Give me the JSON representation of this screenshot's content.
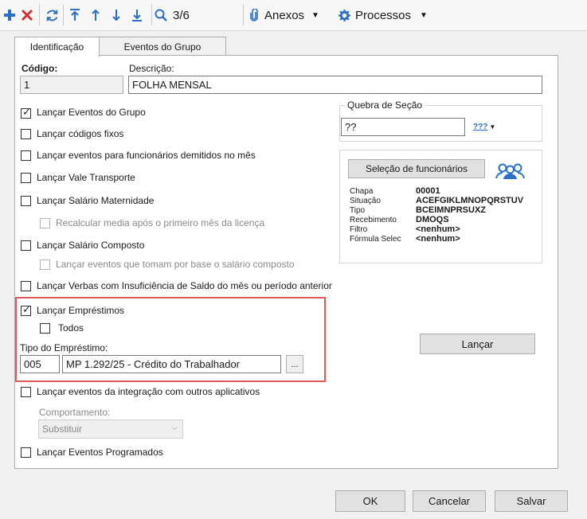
{
  "toolbar": {
    "counter": "3/6",
    "anexos_label": "Anexos",
    "processos_label": "Processos",
    "icons": [
      "add-icon",
      "delete-icon",
      "refresh-icon",
      "first-icon",
      "previous-icon",
      "next-icon",
      "last-icon",
      "search-icon",
      "paperclip-icon",
      "gear-icon"
    ]
  },
  "tabs": [
    {
      "label": "Identificação",
      "active": true
    },
    {
      "label": "Eventos do Grupo",
      "active": false
    }
  ],
  "form": {
    "codigo_label": "Código:",
    "codigo_value": "1",
    "descricao_label": "Descrição:",
    "descricao_value": "FOLHA MENSAL",
    "checkboxes": [
      {
        "label": "Lançar Eventos do Grupo",
        "checked": true,
        "enabled": true
      },
      {
        "label": "Lançar códigos fixos",
        "checked": false,
        "enabled": true
      },
      {
        "label": "Lançar eventos para funcionários demitidos no mês",
        "checked": false,
        "enabled": true
      },
      {
        "label": "Lançar Vale Transporte",
        "checked": false,
        "enabled": true
      },
      {
        "label": "Lançar Salário Maternidade",
        "checked": false,
        "enabled": true
      },
      {
        "label": "Recalcular media após o primeiro mês da licença",
        "checked": false,
        "enabled": false
      },
      {
        "label": "Lançar Salário Composto",
        "checked": false,
        "enabled": true
      },
      {
        "label": "Lançar eventos que tomam por base o salário composto",
        "checked": false,
        "enabled": false
      },
      {
        "label": "Lançar Verbas com Insuficiência de Saldo do mês ou período anterior",
        "checked": false,
        "enabled": true
      }
    ],
    "emprestimos": {
      "label": "Lançar Empréstimos",
      "checked": true,
      "todos_label": "Todos",
      "todos_checked": false,
      "tipo_label": "Tipo do Empréstimo:",
      "tipo_code": "005",
      "tipo_desc": "MP 1.292/25 - Crédito do Trabalhador",
      "browse_label": "..."
    },
    "integracao": {
      "label": "Lançar eventos da integração com outros aplicativos",
      "checked": false,
      "comportamento_label": "Comportamento:",
      "comportamento_value": "Substituir"
    },
    "programados": {
      "label": "Lançar Eventos Programados",
      "checked": false
    }
  },
  "quebra": {
    "title": "Quebra de Seção",
    "value": "??",
    "button_label": "???"
  },
  "selecao": {
    "button_label": "Seleção de funcionários",
    "rows": [
      {
        "label": "Chapa",
        "value": "00001"
      },
      {
        "label": "Situação",
        "value": "ACEFGIKLMNOPQRSTUV"
      },
      {
        "label": "Tipo",
        "value": "BCEIMNPRSUXZ"
      },
      {
        "label": "Recebimento",
        "value": "DMOQS"
      },
      {
        "label": "Filtro",
        "value": "<nenhum>"
      },
      {
        "label": "Fórmula Selec",
        "value": "<nenhum>"
      }
    ]
  },
  "lancar_button": "Lançar",
  "footer": {
    "ok": "OK",
    "cancelar": "Cancelar",
    "salvar": "Salvar"
  },
  "colors": {
    "accent_red": "#d32f2f",
    "nav_blue": "#2a6fc9",
    "highlight_box": "#e05a5a"
  }
}
